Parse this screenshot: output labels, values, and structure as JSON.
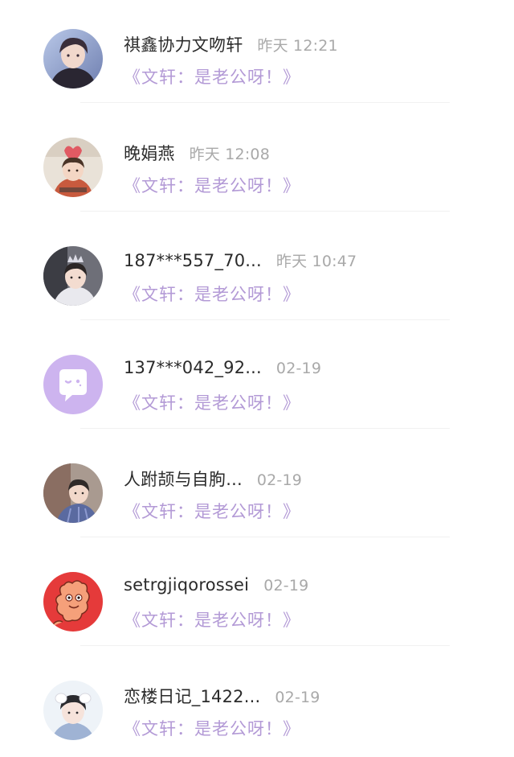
{
  "conversations": [
    {
      "name": "祺鑫协力文吻轩",
      "time": "昨天 12:21",
      "message": "《文轩：是老公呀！》",
      "avatar_icon": "boy-portrait-avatar"
    },
    {
      "name": "晚娟燕",
      "time": "昨天 12:08",
      "message": "《文轩：是老公呀！》",
      "avatar_icon": "child-heart-avatar"
    },
    {
      "name": "187***557_70...",
      "time": "昨天 10:47",
      "message": "《文轩：是老公呀！》",
      "avatar_icon": "boy-crown-avatar"
    },
    {
      "name": "137***042_92...",
      "time": "02-19",
      "message": "《文轩：是老公呀！》",
      "avatar_icon": "default-chat-bubble-avatar"
    },
    {
      "name": "人跗颉与自朐...",
      "time": "02-19",
      "message": "《文轩：是老公呀！》",
      "avatar_icon": "boy-plaid-avatar"
    },
    {
      "name": "setrgjiqorossei",
      "time": "02-19",
      "message": "《文轩：是老公呀！》",
      "avatar_icon": "cartoon-creature-avatar"
    },
    {
      "name": "恋楼日记_1422...",
      "time": "02-19",
      "message": "《文轩：是老公呀！》",
      "avatar_icon": "boy-headband-avatar"
    }
  ],
  "colors": {
    "message_purple": "#b39ad6",
    "name_text": "#2b2b2b",
    "time_gray": "#a9a9a9",
    "default_avatar_bg": "#cdb4ef"
  }
}
